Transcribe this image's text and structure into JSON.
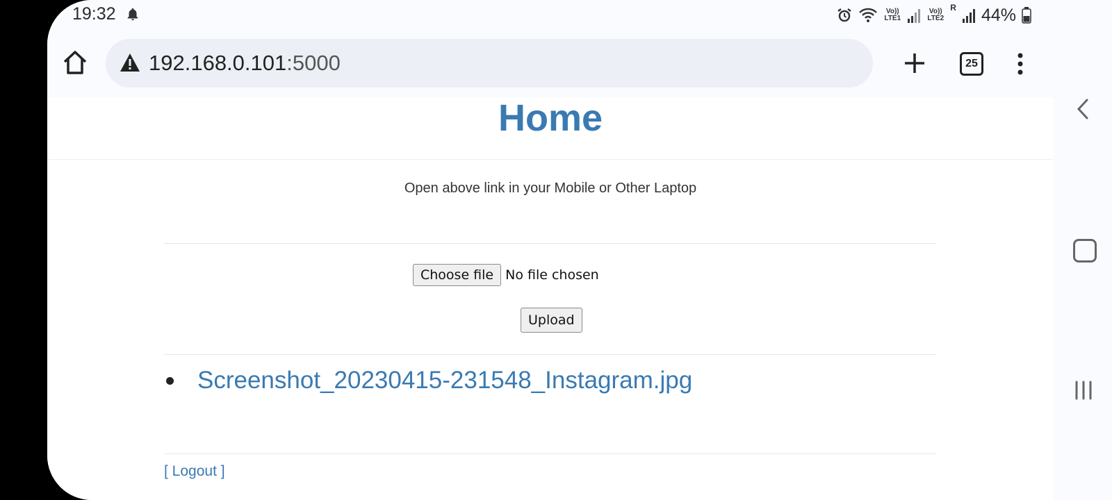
{
  "status_bar": {
    "time": "19:32",
    "battery": "44%",
    "sim1": "Vo)) LTE1",
    "sim2": "Vo)) LTE2",
    "roaming": "R",
    "icons": [
      "bell-icon",
      "alarm-icon",
      "wifi-icon",
      "signal-icon",
      "battery-icon"
    ]
  },
  "browser": {
    "url_host": "192.168.0.101",
    "url_port": ":5000",
    "tab_count": "25",
    "icons": [
      "home-icon",
      "warning-icon",
      "plus-icon",
      "tabs-icon",
      "more-vert-icon"
    ]
  },
  "page": {
    "title": "Home",
    "hint": "Open above link in your Mobile or Other Laptop",
    "choose_file_label": "Choose file",
    "file_status": "No file chosen",
    "upload_label": "Upload",
    "files": [
      "Screenshot_20230415-231548_Instagram.jpg"
    ],
    "logout_label": "[ Logout ]"
  },
  "colors": {
    "link": "#3a7ab2",
    "toolbar_bg": "#fafbfe",
    "urlbar_bg": "#eceff5"
  }
}
